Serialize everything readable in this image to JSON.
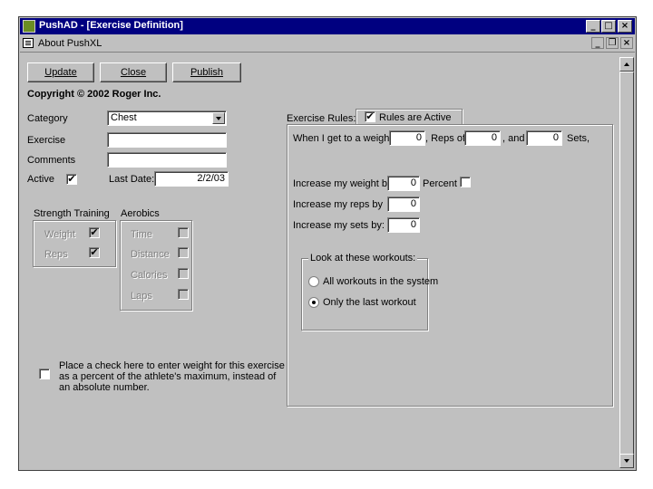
{
  "window": {
    "title": "PushAD - [Exercise Definition]",
    "controls": {
      "minimize": "_",
      "maximize": "□",
      "close": "×"
    }
  },
  "menubar": {
    "item": "About PushXL",
    "controls": {
      "minimize": "_",
      "restore": "❐",
      "close": "×"
    }
  },
  "toolbar": {
    "update_label": "Update",
    "close_label": "Close",
    "publish_label": "Publish"
  },
  "copyright": "Copyright © 2002 Roger Inc.",
  "form": {
    "category_label": "Category",
    "category_value": "Chest",
    "exercise_label": "Exercise",
    "exercise_value": "",
    "comments_label": "Comments",
    "comments_value": "",
    "active_label": "Active",
    "active_checked": "✔",
    "last_date_label": "Last Date:",
    "last_date_value": "2/2/03"
  },
  "strength": {
    "title": "Strength Training",
    "weight_label": "Weight",
    "weight_checked": "✔",
    "reps_label": "Reps",
    "reps_checked": "✔"
  },
  "aerobics": {
    "title": "Aerobics",
    "time_label": "Time",
    "distance_label": "Distance",
    "calories_label": "Calories",
    "laps_label": "Laps"
  },
  "percent_note": {
    "line1": "Place a check here to enter weight for this exercise",
    "line2": "as a percent of the athlete's maximum, instead of",
    "line3": "an absolute number."
  },
  "rules": {
    "label": "Exercise Rules:",
    "active_label": "Rules are Active",
    "active_checked": "✔",
    "when_prefix": "When I get to a weight of",
    "weight_value": "0",
    "reps_prefix": ", Reps of",
    "reps_value": "0",
    "and_label": ", and",
    "sets_value": "0",
    "sets_label": "Sets,",
    "inc_weight_label": "Increase my weight by",
    "inc_weight_value": "0",
    "percent_label": "Percent",
    "inc_reps_label": "Increase my reps by",
    "inc_reps_value": "0",
    "inc_sets_label": "Increase my sets by:",
    "inc_sets_value": "0",
    "workouts_title": "Look at these workouts:",
    "option_all": "All workouts in the system",
    "option_last": "Only the last workout"
  }
}
